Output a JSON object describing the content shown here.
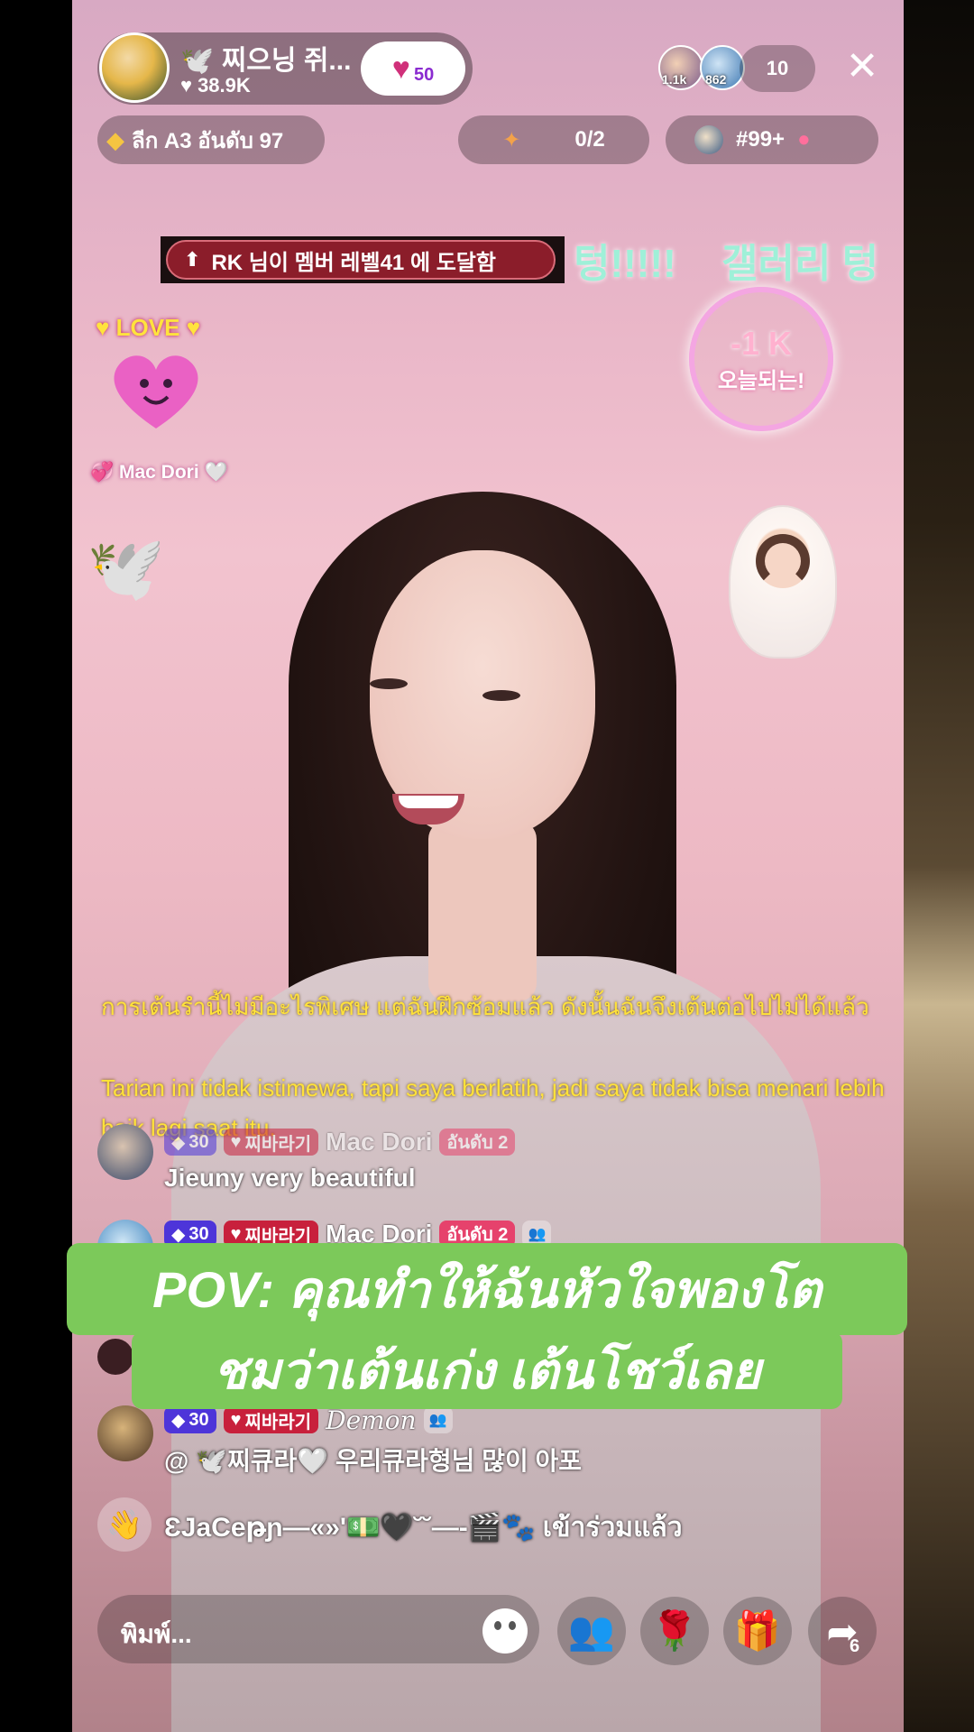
{
  "host": {
    "name": "🕊️ 찌으닝 쥐...",
    "likes": "38.9K",
    "follow_count": "50"
  },
  "viewers": {
    "top1": "1.1k",
    "top2": "862",
    "count": "10"
  },
  "league": {
    "text": "ลีก A3 อันดับ 97"
  },
  "quest": {
    "progress": "0/2"
  },
  "ranking": {
    "label": "#99+"
  },
  "banner": {
    "text": "RK 님이 멤버 레벨41 에 도달함",
    "scroll_left": "텅!!!!!",
    "scroll_right": "갤러리 텅"
  },
  "effects": {
    "love": "LOVE",
    "mac_dori": "Mac Dori",
    "ring_top": "-1 K",
    "ring_sub": "오늘되는!"
  },
  "captions": {
    "thai": "การเต้นรำนี้ไม่มีอะไรพิเศษ แต่ฉันฝึกซ้อมแล้ว ดังนั้นฉันจึงเต้นต่อไปไม่ได้แล้ว",
    "indonesian": "Tarian ini tidak istimewa, tapi saya berlatih, jadi saya tidak bisa menari lebih baik lagi saat itu."
  },
  "chat": [
    {
      "level": "30",
      "fan": "찌바라기",
      "name": "Mac Dori",
      "rank": "อันดับ 2",
      "message": "Jieuny very beautiful"
    },
    {
      "level": "30",
      "fan": "찌바라기",
      "name": "Mac Dori",
      "rank": "อันดับ 2",
      "message": ""
    },
    {
      "level": "30",
      "fan": "찌바라기",
      "name": "Demon",
      "rank": "",
      "message": "@ 🕊️찌큐라🤍 우리큐라형님 많이 아포"
    }
  ],
  "overlay": {
    "line1": "POV: คุณทำให้ฉันหัวใจพองโต",
    "line2": "ชมว่าเต้นเก่ง เต้นโชว์เลย"
  },
  "join": {
    "text": "ƐJaCeթɲ—«»'💵🖤˘˘—-🎬🐾 เข้าร่วมแล้ว"
  },
  "input": {
    "placeholder": "พิมพ์..."
  },
  "share": {
    "count": "6"
  },
  "colors": {
    "overlay_green": "#7cc95a",
    "caption_yellow": "#ffe23a",
    "banner_red": "#8b1d2a",
    "level_purple": "#4d35d9",
    "fan_red": "#c8203c"
  }
}
